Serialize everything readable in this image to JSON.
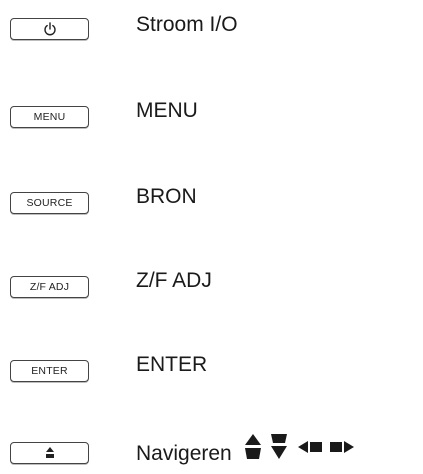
{
  "rows": [
    {
      "key_icon": "power-icon",
      "key_text": "",
      "label": "Stroom I/O"
    },
    {
      "key_icon": "",
      "key_text": "MENU",
      "label": "MENU"
    },
    {
      "key_icon": "",
      "key_text": "SOURCE",
      "label": "BRON"
    },
    {
      "key_icon": "",
      "key_text": "Z/F ADJ",
      "label": "Z/F ADJ"
    },
    {
      "key_icon": "",
      "key_text": "ENTER",
      "label": "ENTER"
    },
    {
      "key_icon": "up-arrow-icon",
      "key_text": "",
      "label": "Navigeren",
      "label_icons": [
        "up-arrow-icon",
        "down-arrow-icon",
        "left-arrow-icon",
        "right-arrow-icon"
      ]
    }
  ],
  "colors": {
    "text": "#1a1a1a",
    "key_border": "#444444",
    "glyph": "#1a1a1a"
  }
}
